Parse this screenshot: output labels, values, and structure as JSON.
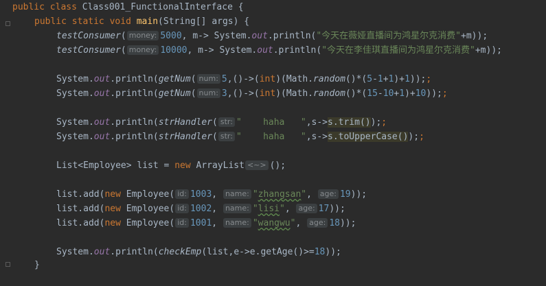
{
  "code": {
    "class_line": {
      "public": "public",
      "class": "class",
      "class_name": "Class001_FunctionalInterface",
      "brace": "{"
    },
    "main_line": {
      "public": "public",
      "static": "static",
      "void": "void",
      "main": "main",
      "params": "(String[] args) {"
    },
    "consumer1": {
      "fn": "testConsumer",
      "open": "(",
      "hint": "money:",
      "num": "5000",
      "mid": ", m-> System.",
      "out": "out",
      "call": ".println(",
      "str": "\"今天在薇娅直播间为鸿星尔克消费\"",
      "rest": "+m));"
    },
    "consumer2": {
      "fn": "testConsumer",
      "open": "(",
      "hint": "money:",
      "num": "10000",
      "mid": ", m-> System.",
      "out": "out",
      "call": ".println(",
      "str": "\"今天在李佳琪直播间为鸿星尔克消费\"",
      "rest": "+m));"
    },
    "getnum1": {
      "pre": "System.",
      "out": "out",
      "call": ".println(",
      "fn": "getNum",
      "open": "(",
      "hint": "num:",
      "num": "5",
      "lambda": ",()->(",
      "int": "int",
      "cast": ")(Math.",
      "random": "random",
      "expr1": "()*(",
      "n1": "5",
      "op1": "-",
      "n2": "1",
      "op2": "+",
      "n3": "1",
      "op3": ")+",
      "n4": "1",
      "close": "));",
      "extra": ";"
    },
    "getnum2": {
      "pre": "System.",
      "out": "out",
      "call": ".println(",
      "fn": "getNum",
      "open": "(",
      "hint": "num:",
      "num": "3",
      "lambda": ",()->(",
      "int": "int",
      "cast": ")(Math.",
      "random": "random",
      "expr1": "()*(",
      "n1": "15",
      "op1": "-",
      "n2": "10",
      "op2": "+",
      "n3": "1",
      "op3": ")+",
      "n4": "10",
      "close": "));",
      "extra": ";"
    },
    "str1": {
      "pre": "System.",
      "out": "out",
      "call": ".println(",
      "fn": "strHandler",
      "open": "(",
      "hint": "str:",
      "str": "\"    haha   \"",
      "lambda": ",s->",
      "method": "s.trim()",
      "close": ");",
      "extra": ";"
    },
    "str2": {
      "pre": "System.",
      "out": "out",
      "call": ".println(",
      "fn": "strHandler",
      "open": "(",
      "hint": "str:",
      "str": "\"    haha   \"",
      "lambda": ",s->",
      "method": "s.toUpperCase()",
      "close": ");",
      "extra": ";"
    },
    "list_decl": {
      "type": "List<Employee> list = ",
      "new": "new",
      "ctor": " ArrayList",
      "diamond": "<~>",
      "rest": "();"
    },
    "emp1": {
      "pre": "list.add(",
      "new": "new",
      "ctor": " Employee(",
      "hint_id": "id:",
      "id": "1003",
      "c1": ", ",
      "hint_name": "name:",
      "q1": "\"",
      "name": "zhangsan",
      "q2": "\"",
      "c2": ", ",
      "hint_age": "age:",
      "age": "19",
      "close": "));"
    },
    "emp2": {
      "pre": "list.add(",
      "new": "new",
      "ctor": " Employee(",
      "hint_id": "id:",
      "id": "1002",
      "c1": ", ",
      "hint_name": "name:",
      "q1": "\"",
      "name": "lisi",
      "q2": "\"",
      "c2": ", ",
      "hint_age": "age:",
      "age": "17",
      "close": "));"
    },
    "emp3": {
      "pre": "list.add(",
      "new": "new",
      "ctor": " Employee(",
      "hint_id": "id:",
      "id": "1001",
      "c1": ", ",
      "hint_name": "name:",
      "q1": "\"",
      "name": "wangwu",
      "q2": "\"",
      "c2": ", ",
      "hint_age": "age:",
      "age": "18",
      "close": "));"
    },
    "check": {
      "pre": "System.",
      "out": "out",
      "call": ".println(",
      "fn": "checkEmp",
      "args": "(list,e->e.getAge()>=",
      "num": "18",
      "close": "));"
    },
    "close_brace": "}"
  }
}
